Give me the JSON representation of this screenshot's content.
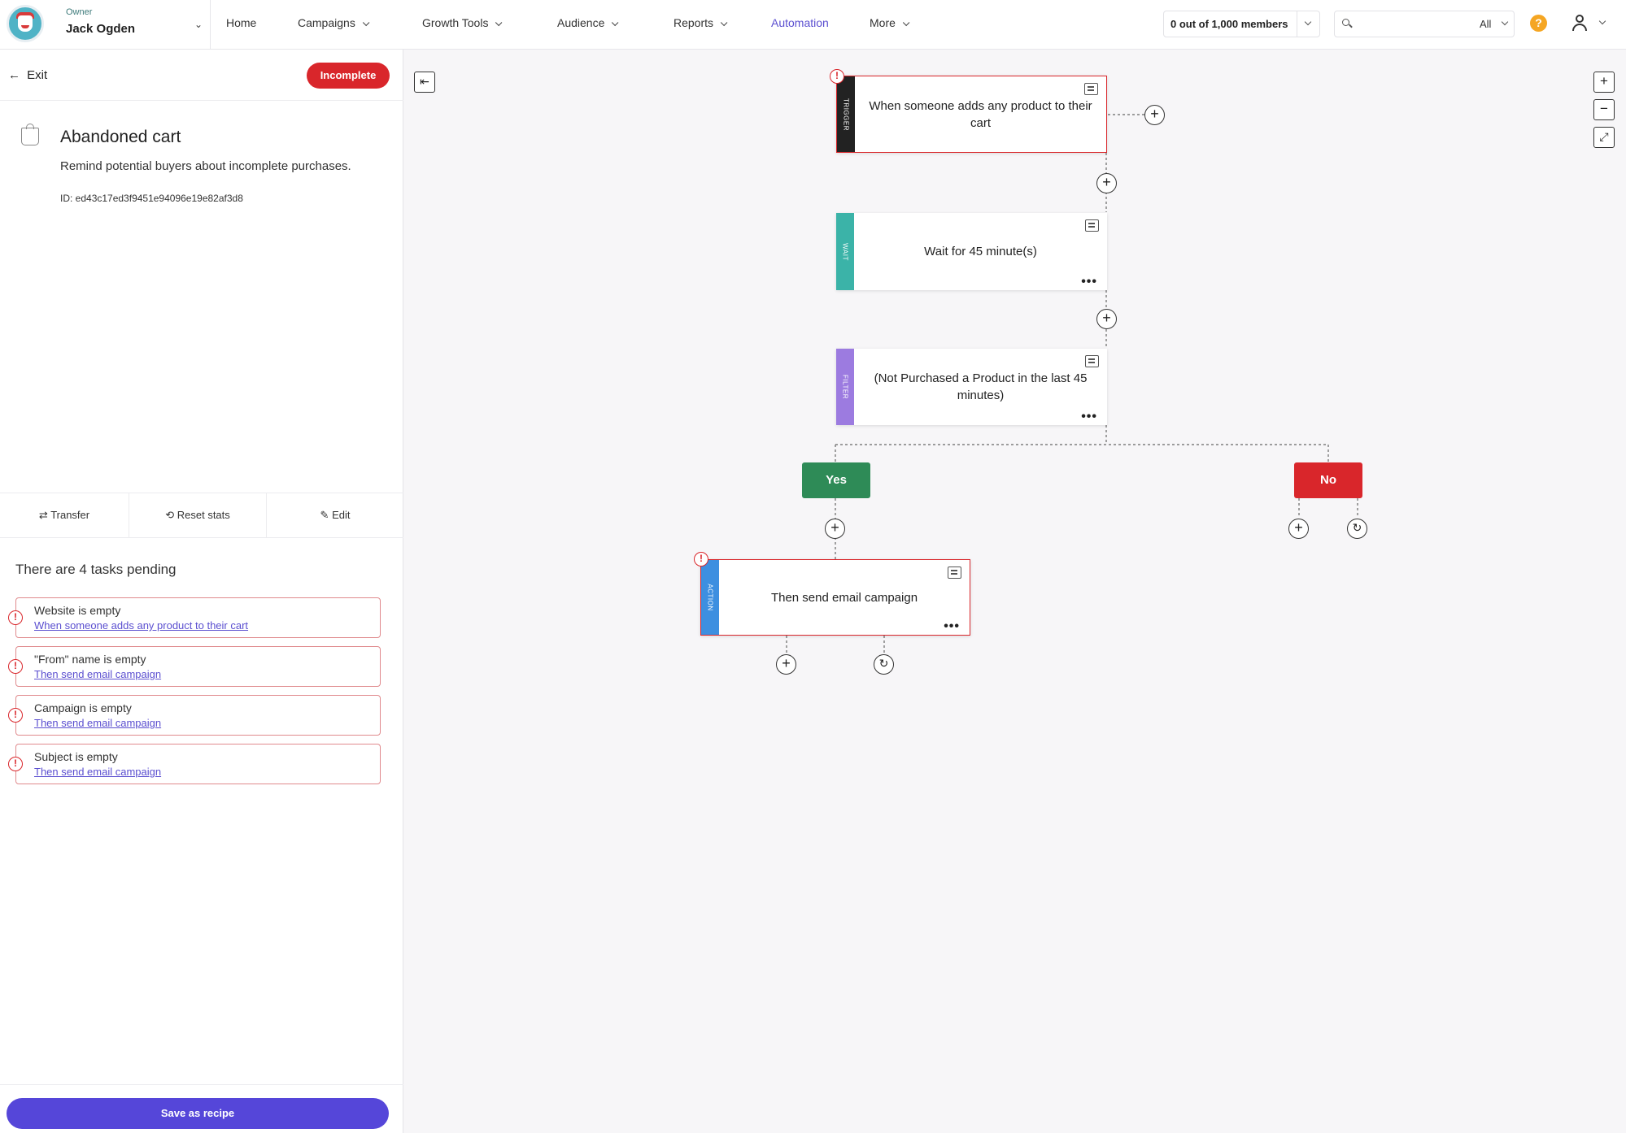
{
  "header": {
    "owner_label": "Owner",
    "owner_name": "Jack Ogden",
    "nav": [
      {
        "label": "Home"
      },
      {
        "label": "Campaigns"
      },
      {
        "label": "Growth Tools"
      },
      {
        "label": "Audience"
      },
      {
        "label": "Reports"
      },
      {
        "label": "Automation"
      },
      {
        "label": "More"
      }
    ],
    "active_nav": "Automation",
    "members": "0 out of 1,000 members",
    "search": {
      "placeholder": "",
      "scope": "All"
    },
    "help_label": "?"
  },
  "sidebar": {
    "exit_label": "Exit",
    "status": "Incomplete",
    "title": "Abandoned cart",
    "description": "Remind potential buyers about incomplete purchases.",
    "id": "ID: ed43c17ed3f9451e94096e19e82af3d8",
    "actions": {
      "transfer": "Transfer",
      "reset": "Reset stats",
      "edit": "Edit"
    },
    "pending_title": "There are 4 tasks pending",
    "tasks": [
      {
        "issue": "Website is empty",
        "link": "When someone adds any product to their cart"
      },
      {
        "issue": "\"From\" name is empty",
        "link": "Then send email campaign"
      },
      {
        "issue": "Campaign is empty",
        "link": "Then send email campaign"
      },
      {
        "issue": "Subject is empty",
        "link": "Then send email campaign"
      }
    ],
    "save_recipe": "Save as recipe"
  },
  "canvas": {
    "nodes": {
      "trigger": {
        "tag": "TRIGGER",
        "text": "When someone adds any product to their cart",
        "color": "#222222"
      },
      "wait": {
        "tag": "WAIT",
        "text": "Wait for 45 minute(s)",
        "color": "#3bb3a8"
      },
      "filter": {
        "tag": "FILTER",
        "text": "(Not Purchased a Product in the last 45 minutes)",
        "color": "#9c7be0"
      },
      "action": {
        "tag": "ACTION",
        "text": "Then send email campaign",
        "color": "#3d8fe0"
      }
    },
    "branches": {
      "yes": "Yes",
      "no": "No"
    }
  },
  "colors": {
    "accent": "#5546d9",
    "error": "#d9262b",
    "yes": "#2e8b57"
  }
}
